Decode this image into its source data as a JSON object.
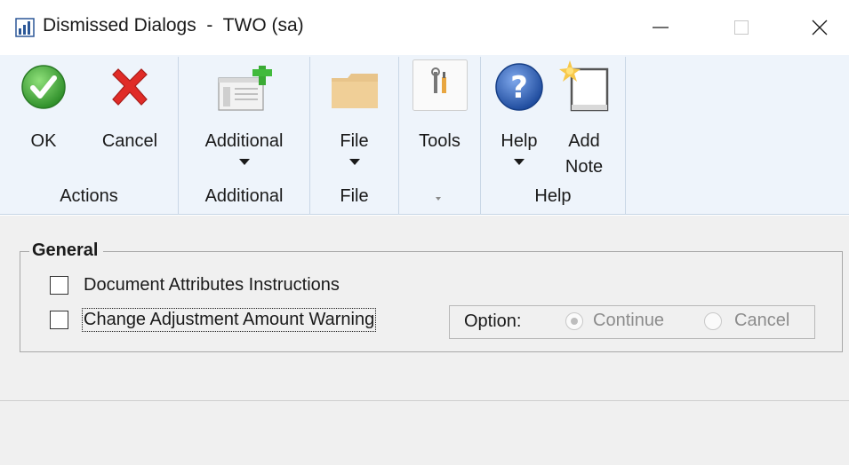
{
  "window": {
    "title": "Dismissed Dialogs  -  TWO (sa)",
    "minimize_icon": "minimize-icon",
    "maximize_icon": "maximize-icon",
    "close_icon": "close-icon"
  },
  "ribbon": {
    "groups": [
      {
        "label": "Actions",
        "buttons": [
          {
            "label": "OK",
            "icon": "checkmark-icon"
          },
          {
            "label": "Cancel",
            "icon": "red-x-icon"
          }
        ]
      },
      {
        "label": "Additional",
        "buttons": [
          {
            "label": "Additional",
            "icon": "window-add-icon",
            "has_dropdown": true
          }
        ]
      },
      {
        "label": "File",
        "buttons": [
          {
            "label": "File",
            "icon": "folder-icon",
            "has_dropdown": true
          }
        ]
      },
      {
        "label": "",
        "buttons": [
          {
            "label": "Tools",
            "icon": "tools-icon"
          }
        ],
        "group_caret": true
      },
      {
        "label": "Help",
        "buttons": [
          {
            "label": "Help",
            "icon": "help-icon",
            "has_dropdown": true
          },
          {
            "label_line1": "Add",
            "label_line2": "Note",
            "icon": "note-icon"
          }
        ]
      }
    ]
  },
  "general": {
    "legend": "General",
    "items": [
      {
        "label": "Document Attributes Instructions",
        "checked": false
      },
      {
        "label": "Change Adjustment Amount Warning",
        "checked": false,
        "focused": true
      }
    ],
    "option": {
      "label": "Option:",
      "choices": [
        {
          "label": "Continue",
          "selected": true,
          "enabled": false
        },
        {
          "label": "Cancel",
          "selected": false,
          "enabled": false
        }
      ]
    }
  },
  "colors": {
    "ribbon_bg": "#eef4fb",
    "content_bg": "#f0f0f0",
    "ok_green": "#3aa335",
    "cancel_red": "#e02b27",
    "help_blue": "#2a5db0"
  }
}
